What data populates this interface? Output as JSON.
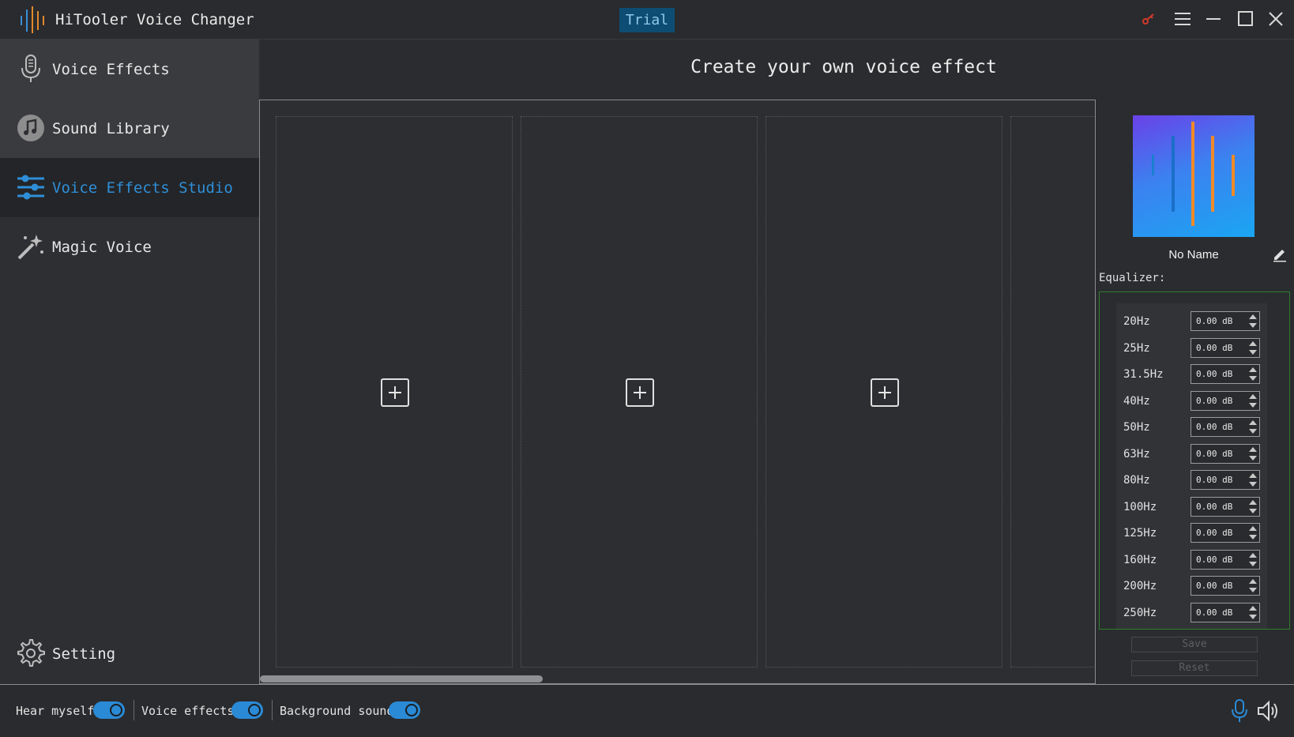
{
  "app": {
    "title": "HiTooler Voice Changer",
    "badge": "Trial"
  },
  "window_controls": [
    "key-icon",
    "menu-icon",
    "minimize-icon",
    "maximize-icon",
    "close-icon"
  ],
  "sidebar": {
    "items": [
      {
        "label": "Voice Effects",
        "icon": "microphone-icon",
        "state": "normal"
      },
      {
        "label": "Sound Library",
        "icon": "music-note-icon",
        "state": "normal"
      },
      {
        "label": "Voice Effects Studio",
        "icon": "sliders-icon",
        "state": "active"
      },
      {
        "label": "Magic Voice",
        "icon": "magic-wand-icon",
        "state": "normal"
      }
    ],
    "setting_label": "Setting"
  },
  "main": {
    "title": "Create your own voice effect",
    "slot_count_visible": 4
  },
  "preset": {
    "name": "No Name"
  },
  "equalizer": {
    "label": "Equalizer:",
    "bands": [
      {
        "freq": "20Hz",
        "value": "0.00 dB"
      },
      {
        "freq": "25Hz",
        "value": "0.00 dB"
      },
      {
        "freq": "31.5Hz",
        "value": "0.00 dB"
      },
      {
        "freq": "40Hz",
        "value": "0.00 dB"
      },
      {
        "freq": "50Hz",
        "value": "0.00 dB"
      },
      {
        "freq": "63Hz",
        "value": "0.00 dB"
      },
      {
        "freq": "80Hz",
        "value": "0.00 dB"
      },
      {
        "freq": "100Hz",
        "value": "0.00 dB"
      },
      {
        "freq": "125Hz",
        "value": "0.00 dB"
      },
      {
        "freq": "160Hz",
        "value": "0.00 dB"
      },
      {
        "freq": "200Hz",
        "value": "0.00 dB"
      },
      {
        "freq": "250Hz",
        "value": "0.00 dB"
      }
    ],
    "save_label": "Save",
    "reset_label": "Reset"
  },
  "bottom": {
    "hear_myself": {
      "label": "Hear myself",
      "on": true
    },
    "voice_effects": {
      "label": "Voice effects",
      "on": true
    },
    "background_sound": {
      "label": "Background sound",
      "on": true
    }
  },
  "colors": {
    "accent": "#2a8ad6",
    "trial_bg": "#0d4d73",
    "eq_border": "#2e7d2e"
  }
}
